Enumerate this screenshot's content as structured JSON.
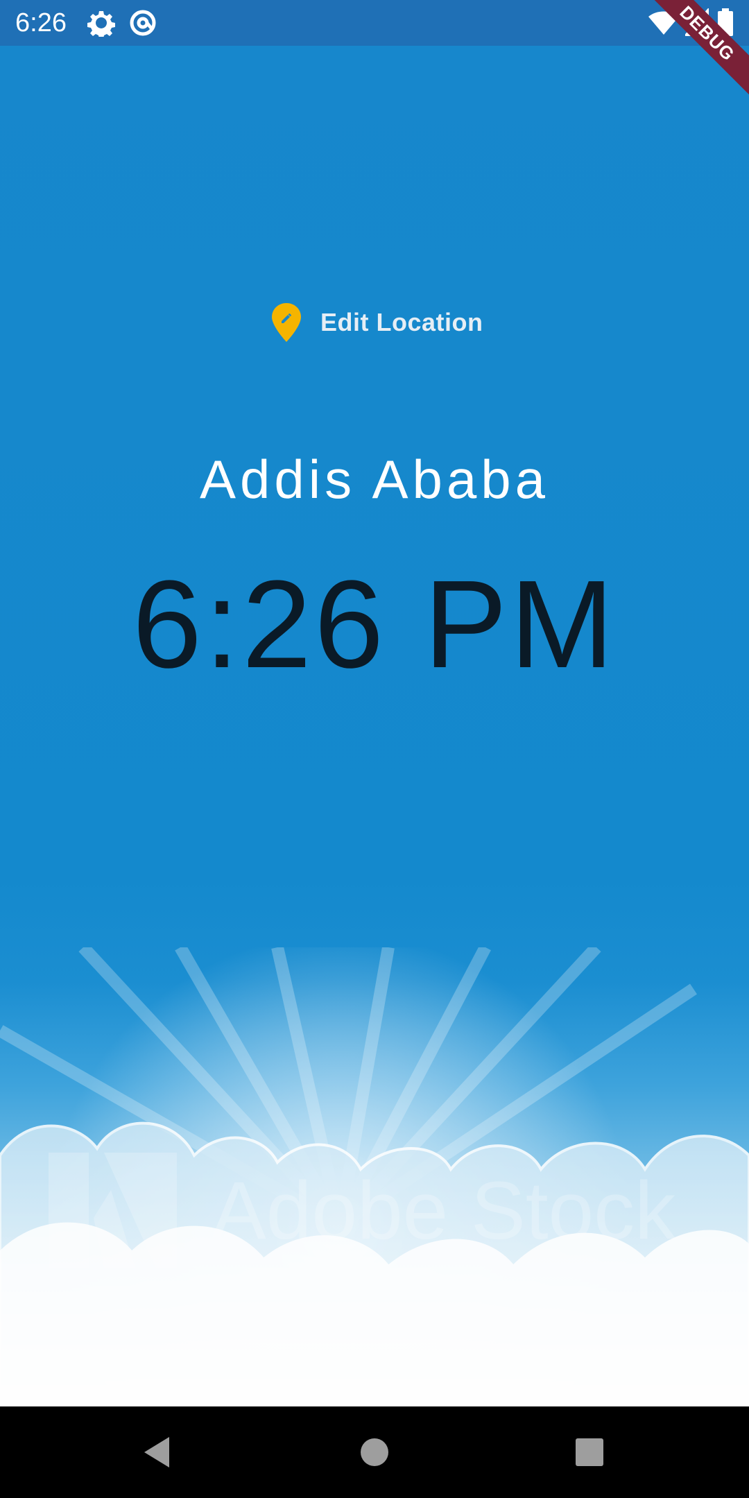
{
  "status_bar": {
    "time": "6:26",
    "left_icons": [
      "gear-icon",
      "at-sign-icon"
    ],
    "right_icons": [
      "wifi-icon",
      "cellular-signal-icon",
      "battery-icon"
    ],
    "background": "#1f70b6"
  },
  "debug_banner": {
    "label": "DEBUG"
  },
  "location_button": {
    "label": "Edit Location",
    "icon": "edit-location-pin-icon",
    "icon_color": "#f5b400"
  },
  "location": {
    "city": "Addis Ababa"
  },
  "clock": {
    "time": "6:26 PM"
  },
  "background_image": {
    "watermark": "Adobe Stock",
    "description_icon": "sky-clouds-image"
  },
  "nav_bar": {
    "buttons": [
      "back-icon",
      "home-icon",
      "recents-icon"
    ]
  },
  "colors": {
    "sky_blue": "#1787cc",
    "clock_text": "#0a1a27",
    "debug_banner": "#7a2137"
  }
}
